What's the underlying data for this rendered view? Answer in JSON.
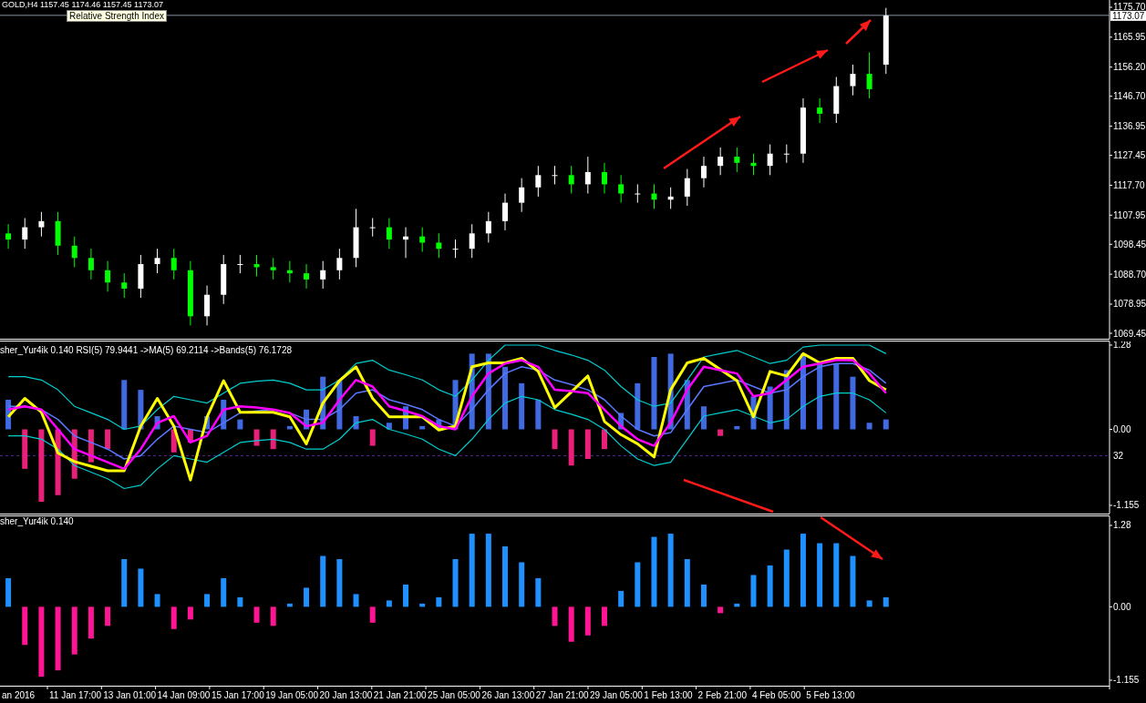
{
  "header": {
    "symbol_line": "GOLD,H4 1157.45 1174.46 1157.45 1173.07",
    "tooltip": "Relative Strength Index"
  },
  "price_panel": {
    "chart_data": {
      "type": "candlestick",
      "ylim": [
        1067.67,
        1178.07
      ],
      "categories": [
        null,
        null,
        null,
        null,
        null,
        null,
        null,
        null,
        null,
        null,
        null,
        null,
        null,
        null,
        null,
        null,
        null,
        null,
        null,
        null,
        null,
        null,
        null,
        null,
        null,
        null,
        null,
        null,
        null,
        null,
        null,
        null,
        null,
        null,
        null,
        null,
        null,
        null,
        null,
        null,
        null,
        null,
        null,
        null,
        null,
        null,
        null,
        null,
        null,
        null,
        null,
        null,
        null,
        null,
        null,
        null,
        null,
        null,
        null,
        null,
        null,
        null,
        null,
        null,
        null,
        null,
        null
      ],
      "yticks": [
        {
          "value": 1175.7,
          "label": "1175.70"
        },
        {
          "value": 1165.95,
          "label": "1165.95"
        },
        {
          "value": 1156.2,
          "label": "1156.20"
        },
        {
          "value": 1146.7,
          "label": "1146.70"
        },
        {
          "value": 1136.95,
          "label": "1136.95"
        },
        {
          "value": 1127.45,
          "label": "1127.45"
        },
        {
          "value": 1117.7,
          "label": "1117.70"
        },
        {
          "value": 1107.95,
          "label": "1107.95"
        },
        {
          "value": 1098.45,
          "label": "1098.45"
        },
        {
          "value": 1088.7,
          "label": "1088.70"
        },
        {
          "value": 1078.95,
          "label": "1078.95"
        },
        {
          "value": 1069.45,
          "label": "1069.45"
        }
      ],
      "ref_lines": [
        {
          "axis": "y",
          "value": 1173.07,
          "label": "1173.07"
        }
      ],
      "ohlc": [
        [
          1102,
          1105,
          1097,
          1100
        ],
        [
          1100,
          1107,
          1097,
          1104
        ],
        [
          1104,
          1109,
          1101,
          1106
        ],
        [
          1106,
          1109,
          1095,
          1098
        ],
        [
          1098,
          1101,
          1091,
          1094
        ],
        [
          1094,
          1097,
          1087,
          1090
        ],
        [
          1090,
          1093,
          1083,
          1086
        ],
        [
          1086,
          1089,
          1081,
          1084
        ],
        [
          1084,
          1095,
          1081,
          1092
        ],
        [
          1092,
          1097,
          1089,
          1094
        ],
        [
          1094,
          1097,
          1087,
          1090
        ],
        [
          1090,
          1093,
          1072,
          1075
        ],
        [
          1075,
          1085,
          1072,
          1082
        ],
        [
          1082,
          1095,
          1079,
          1092
        ],
        [
          1092,
          1095,
          1089,
          1092
        ],
        [
          1092,
          1095,
          1088,
          1091
        ],
        [
          1091,
          1094,
          1087,
          1090
        ],
        [
          1090,
          1093,
          1086,
          1089
        ],
        [
          1089,
          1092,
          1084,
          1087
        ],
        [
          1087,
          1093,
          1084,
          1090
        ],
        [
          1090,
          1097,
          1087,
          1094
        ],
        [
          1094,
          1110,
          1091,
          1104
        ],
        [
          1104,
          1107,
          1101,
          1104
        ],
        [
          1104,
          1107,
          1097,
          1100
        ],
        [
          1100,
          1104,
          1094,
          1101
        ],
        [
          1101,
          1104,
          1096,
          1099
        ],
        [
          1099,
          1102,
          1094,
          1097
        ],
        [
          1097,
          1100,
          1094,
          1097
        ],
        [
          1097,
          1105,
          1094,
          1102
        ],
        [
          1102,
          1109,
          1099,
          1106
        ],
        [
          1106,
          1115,
          1103,
          1112
        ],
        [
          1112,
          1120,
          1109,
          1117
        ],
        [
          1117,
          1124,
          1114,
          1121
        ],
        [
          1121,
          1124,
          1118,
          1121
        ],
        [
          1121,
          1124,
          1115,
          1118
        ],
        [
          1118,
          1127,
          1115,
          1122
        ],
        [
          1122,
          1125,
          1115,
          1118
        ],
        [
          1118,
          1121,
          1112,
          1115
        ],
        [
          1115,
          1118,
          1112,
          1115
        ],
        [
          1115,
          1118,
          1110,
          1113
        ],
        [
          1113,
          1117,
          1110,
          1114
        ],
        [
          1114,
          1123,
          1111,
          1120
        ],
        [
          1120,
          1127,
          1117,
          1124
        ],
        [
          1124,
          1130,
          1121,
          1127
        ],
        [
          1127,
          1130,
          1122,
          1125
        ],
        [
          1125,
          1128,
          1121,
          1124
        ],
        [
          1124,
          1131,
          1121,
          1128
        ],
        [
          1128,
          1131,
          1125,
          1128
        ],
        [
          1128,
          1146,
          1125,
          1143
        ],
        [
          1143,
          1146,
          1138,
          1141
        ],
        [
          1141,
          1153,
          1138,
          1150
        ],
        [
          1150,
          1157,
          1147,
          1154
        ],
        [
          1154,
          1161,
          1146,
          1149
        ],
        [
          1157,
          1175.5,
          1154,
          1173
        ],
        null,
        null,
        null,
        null,
        null,
        null,
        null,
        null,
        null,
        null,
        null,
        null,
        null
      ]
    }
  },
  "rsi_panel": {
    "title": "sher_Yur4ik 0.140  RSI(5) 79.9441  ->MA(5) 69.2114  ->Bands(5) 76.1728",
    "level_label": "32",
    "chart_data": {
      "type": "bar",
      "ylim": [
        -1.28,
        1.335
      ],
      "categories": [
        null,
        null,
        null,
        null,
        null,
        null,
        null,
        null,
        null,
        null,
        null,
        null,
        null,
        null,
        null,
        null,
        null,
        null,
        null,
        null,
        null,
        null,
        null,
        null,
        null,
        null,
        null,
        null,
        null,
        null,
        null,
        null,
        null,
        null,
        null,
        null,
        null,
        null,
        null,
        null,
        null,
        null,
        null,
        null,
        null,
        null,
        null,
        null,
        null,
        null,
        null,
        null,
        null,
        null,
        null,
        null,
        null,
        null,
        null,
        null,
        null,
        null,
        null,
        null,
        null,
        null,
        null
      ],
      "yticks": [
        {
          "value": 1.28,
          "label": "1.28"
        },
        {
          "value": 0,
          "label": "0.00"
        },
        {
          "value": -1.155,
          "label": "-1.155"
        }
      ],
      "ref_lines": [
        {
          "axis": "y",
          "value": -0.4
        }
      ],
      "series": [
        {
          "color": "#4169e1",
          "values": [
            0.45,
            null,
            null,
            null,
            null,
            null,
            null,
            0.75,
            0.6,
            0.2,
            null,
            null,
            0.2,
            0.45,
            0.15,
            null,
            null,
            0.05,
            0.3,
            0.8,
            0.75,
            0.2,
            null,
            0.1,
            0.35,
            0.05,
            0.15,
            0.75,
            1.15,
            1.15,
            0.95,
            0.7,
            0.45,
            null,
            null,
            null,
            null,
            0.25,
            0.7,
            1.1,
            1.15,
            0.75,
            0.35,
            null,
            0.05,
            0.5,
            0.65,
            0.9,
            1.15,
            1.0,
            1.0,
            0.8,
            0.1,
            0.15,
            null,
            null,
            null,
            null,
            null,
            null,
            null,
            null,
            null,
            null,
            null,
            null,
            null
          ]
        },
        {
          "color": "#e8207a",
          "values": [
            null,
            -0.6,
            -1.1,
            -1.0,
            -0.75,
            -0.5,
            -0.3,
            null,
            null,
            null,
            -0.35,
            -0.2,
            null,
            null,
            null,
            -0.25,
            -0.3,
            null,
            null,
            null,
            null,
            null,
            -0.25,
            null,
            null,
            null,
            null,
            null,
            null,
            null,
            null,
            null,
            null,
            -0.3,
            -0.55,
            -0.45,
            -0.3,
            null,
            null,
            null,
            null,
            null,
            null,
            -0.1,
            null,
            null,
            null,
            null,
            null,
            null,
            null,
            null,
            null,
            null,
            null,
            null,
            null,
            null,
            null,
            null,
            null,
            null,
            null,
            null,
            null,
            null,
            null
          ]
        },
        {
          "type": "line",
          "color": "#00ced1",
          "values": [
            0.8,
            0.8,
            0.75,
            0.6,
            0.35,
            0.25,
            0.15,
            0.0,
            0.05,
            0.3,
            0.5,
            0.45,
            0.4,
            0.55,
            0.7,
            0.73,
            0.75,
            0.7,
            0.6,
            0.6,
            0.75,
            1.0,
            1.05,
            0.9,
            0.83,
            0.75,
            0.6,
            0.5,
            0.75,
            1.05,
            1.28,
            1.28,
            1.28,
            1.2,
            1.13,
            1.05,
            0.9,
            0.65,
            0.45,
            0.35,
            0.4,
            0.75,
            1.1,
            1.15,
            1.2,
            1.1,
            1.0,
            1.05,
            1.25,
            1.28,
            1.28,
            1.28,
            1.28,
            1.15,
            null,
            null,
            null,
            null,
            null,
            null,
            null,
            null,
            null,
            null,
            null,
            null,
            null
          ]
        },
        {
          "type": "line",
          "color": "#00ced1",
          "values": [
            -0.1,
            -0.1,
            -0.15,
            -0.3,
            -0.55,
            -0.65,
            -0.75,
            -0.9,
            -0.85,
            -0.6,
            -0.4,
            -0.45,
            -0.5,
            -0.35,
            -0.2,
            -0.17,
            -0.15,
            -0.2,
            -0.3,
            -0.3,
            -0.15,
            0.1,
            0.15,
            0.0,
            -0.07,
            -0.15,
            -0.3,
            -0.4,
            -0.15,
            0.15,
            0.4,
            0.5,
            0.45,
            0.3,
            0.23,
            0.15,
            0.0,
            -0.25,
            -0.45,
            -0.55,
            -0.5,
            -0.15,
            0.2,
            0.25,
            0.3,
            0.2,
            0.1,
            0.15,
            0.35,
            0.5,
            0.55,
            0.55,
            0.45,
            0.25,
            null,
            null,
            null,
            null,
            null,
            null,
            null,
            null,
            null,
            null,
            null,
            null,
            null
          ]
        },
        {
          "type": "line",
          "color": "#5a78ff",
          "values": [
            0.35,
            0.35,
            0.3,
            0.15,
            -0.1,
            -0.2,
            -0.3,
            -0.45,
            -0.4,
            -0.15,
            0.05,
            0.0,
            -0.05,
            0.1,
            0.25,
            0.28,
            0.3,
            0.25,
            0.15,
            0.15,
            0.3,
            0.55,
            0.6,
            0.45,
            0.38,
            0.3,
            0.15,
            0.05,
            0.3,
            0.6,
            0.85,
            0.95,
            0.9,
            0.75,
            0.68,
            0.6,
            0.45,
            0.2,
            0.0,
            -0.1,
            -0.05,
            0.3,
            0.65,
            0.7,
            0.75,
            0.65,
            0.55,
            0.6,
            0.8,
            0.95,
            1.0,
            1.0,
            0.9,
            0.7,
            null,
            null,
            null,
            null,
            null,
            null,
            null,
            null,
            null,
            null,
            null,
            null,
            null
          ]
        },
        {
          "type": "line",
          "color": "#ffff00",
          "values": [
            0.19,
            0.47,
            0.26,
            -0.36,
            -0.49,
            -0.56,
            -0.63,
            -0.63,
            0.05,
            0.47,
            0.05,
            -0.77,
            0.19,
            0.74,
            0.26,
            0.26,
            0.26,
            0.19,
            -0.22,
            0.4,
            0.74,
            0.95,
            0.47,
            0.19,
            0.19,
            0.19,
            -0.01,
            0.05,
            0.95,
            1.01,
            1.01,
            1.08,
            0.88,
            0.33,
            0.57,
            0.81,
            0.12,
            -0.08,
            -0.22,
            -0.42,
            0.6,
            1.01,
            1.08,
            0.91,
            0.74,
            0.19,
            0.88,
            0.81,
            1.15,
            1.01,
            1.08,
            1.08,
            0.74,
            0.6,
            null,
            null,
            null,
            null,
            null,
            null,
            null,
            null,
            null,
            null,
            null,
            null,
            null
          ]
        },
        {
          "type": "line",
          "color": "#ff00ff",
          "values": [
            0.3,
            0.35,
            0.3,
            0.0,
            -0.3,
            -0.4,
            -0.5,
            -0.6,
            -0.3,
            0.1,
            0.2,
            -0.2,
            -0.1,
            0.3,
            0.35,
            0.33,
            0.3,
            0.25,
            0.05,
            0.1,
            0.45,
            0.75,
            0.65,
            0.35,
            0.28,
            0.2,
            0.05,
            0.0,
            0.5,
            0.85,
            1.0,
            1.05,
            0.95,
            0.6,
            0.58,
            0.55,
            0.3,
            0.05,
            -0.15,
            -0.25,
            0.1,
            0.6,
            0.95,
            0.9,
            0.85,
            0.5,
            0.55,
            0.75,
            0.95,
            1.0,
            1.05,
            1.05,
            0.85,
            0.55,
            null,
            null,
            null,
            null,
            null,
            null,
            null,
            null,
            null,
            null,
            null,
            null,
            null
          ]
        }
      ]
    }
  },
  "fisher_panel": {
    "title": "sher_Yur4ik 0.140",
    "chart_data": {
      "type": "bar",
      "ylim": [
        -1.241,
        1.423
      ],
      "categories": [
        null,
        null,
        null,
        null,
        null,
        null,
        null,
        null,
        null,
        null,
        null,
        null,
        null,
        null,
        null,
        null,
        null,
        null,
        null,
        null,
        null,
        null,
        null,
        null,
        null,
        null,
        null,
        null,
        null,
        null,
        null,
        null,
        null,
        null,
        null,
        null,
        null,
        null,
        null,
        null,
        null,
        null,
        null,
        null,
        null,
        null,
        null,
        null,
        null,
        null,
        null,
        null,
        null,
        null,
        null,
        null,
        null,
        null,
        null,
        null,
        null,
        null,
        null,
        null,
        null,
        null,
        null
      ],
      "yticks": [
        {
          "value": 1.28,
          "label": "1.28"
        },
        {
          "value": 0,
          "label": "0.00"
        },
        {
          "value": -1.155,
          "label": "-1.155"
        }
      ],
      "series": [
        {
          "color": "#1e90ff",
          "values": [
            0.45,
            null,
            null,
            null,
            null,
            null,
            null,
            0.75,
            0.6,
            0.2,
            null,
            null,
            0.2,
            0.45,
            0.15,
            null,
            null,
            0.05,
            0.3,
            0.8,
            0.75,
            0.2,
            null,
            0.1,
            0.35,
            0.05,
            0.15,
            0.75,
            1.15,
            1.15,
            0.95,
            0.7,
            0.45,
            null,
            null,
            null,
            null,
            0.25,
            0.7,
            1.1,
            1.15,
            0.75,
            0.35,
            null,
            0.05,
            0.5,
            0.65,
            0.9,
            1.15,
            1.0,
            1.0,
            0.8,
            0.1,
            0.15,
            null,
            null,
            null,
            null,
            null,
            null,
            null,
            null,
            null,
            null,
            null,
            null,
            null
          ]
        },
        {
          "color": "#ff1493",
          "values": [
            null,
            -0.6,
            -1.1,
            -1.0,
            -0.75,
            -0.5,
            -0.3,
            null,
            null,
            null,
            -0.35,
            -0.2,
            null,
            null,
            null,
            -0.25,
            -0.3,
            null,
            null,
            null,
            null,
            null,
            -0.25,
            null,
            null,
            null,
            null,
            null,
            null,
            null,
            null,
            null,
            null,
            -0.3,
            -0.55,
            -0.45,
            -0.3,
            null,
            null,
            null,
            null,
            null,
            null,
            -0.1,
            null,
            null,
            null,
            null,
            null,
            null,
            null,
            null,
            null,
            null,
            null,
            null,
            null,
            null,
            null,
            null,
            null,
            null,
            null,
            null,
            null,
            null,
            null
          ]
        }
      ]
    }
  },
  "time_axis": [
    "an 2016",
    "11 Jan 17:00",
    "13 Jan 01:00",
    "14 Jan 09:00",
    "15 Jan 17:00",
    "19 Jan 05:00",
    "20 Jan 13:00",
    "21 Jan 21:00",
    "25 Jan 05:00",
    "26 Jan 13:00",
    "27 Jan 21:00",
    "29 Jan 05:00",
    "1 Feb 13:00",
    "2 Feb 21:00",
    "4 Feb 05:00",
    "5 Feb 13:00"
  ]
}
